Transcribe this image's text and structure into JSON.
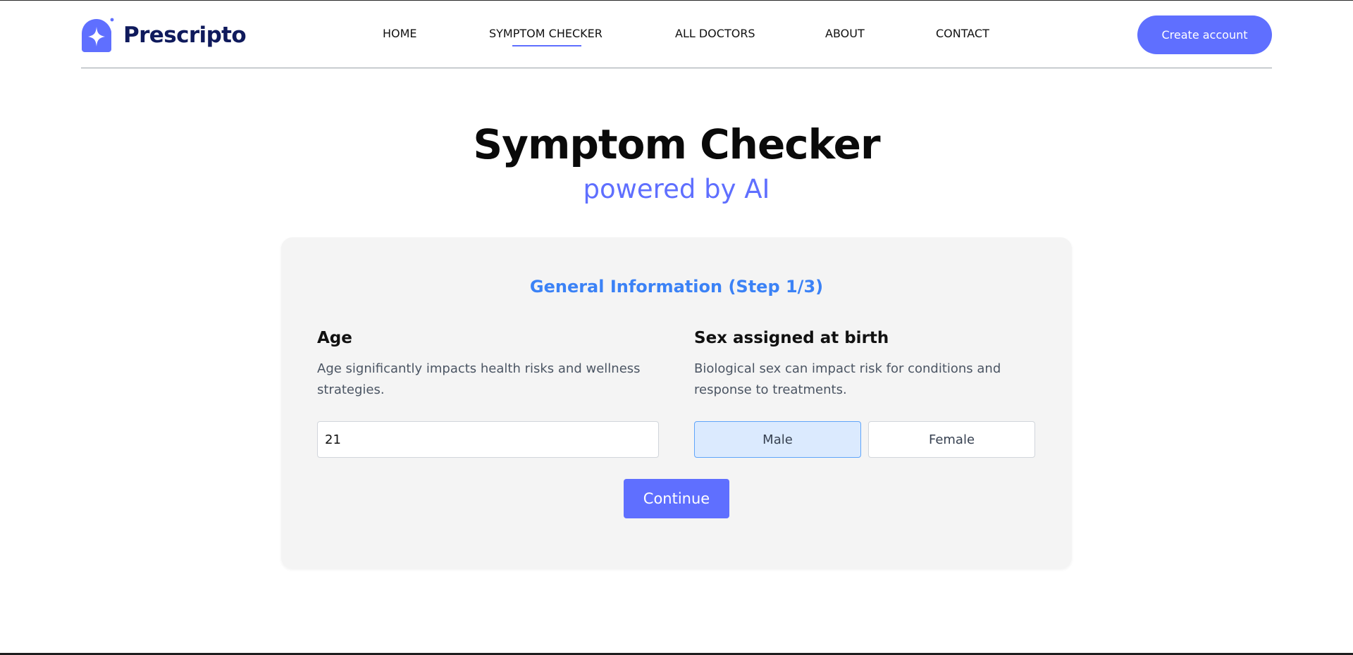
{
  "brand": {
    "name": "Prescripto",
    "icon": "sparkle-logo-icon",
    "color": "#0f1a5c"
  },
  "nav": {
    "items": [
      {
        "label": "HOME"
      },
      {
        "label": "SYMPTOM CHECKER",
        "active": true
      },
      {
        "label": "ALL DOCTORS"
      },
      {
        "label": "ABOUT"
      },
      {
        "label": "CONTACT"
      }
    ],
    "cta_label": "Create account"
  },
  "hero": {
    "title": "Symptom Checker",
    "subtitle": "powered by AI"
  },
  "form": {
    "step_title": "General Information (Step 1/3)",
    "age": {
      "label": "Age",
      "description": "Age significantly impacts health risks and wellness strategies.",
      "value": "21"
    },
    "sex": {
      "label": "Sex assigned at birth",
      "description": "Biological sex can impact risk for conditions and response to treatments.",
      "options": [
        "Male",
        "Female"
      ],
      "selected": "Male"
    },
    "continue_label": "Continue"
  },
  "colors": {
    "accent": "#5f6fff",
    "step_title": "#3b82f6",
    "selected_bg": "#dbeafe",
    "card_bg": "#f4f4f4"
  }
}
